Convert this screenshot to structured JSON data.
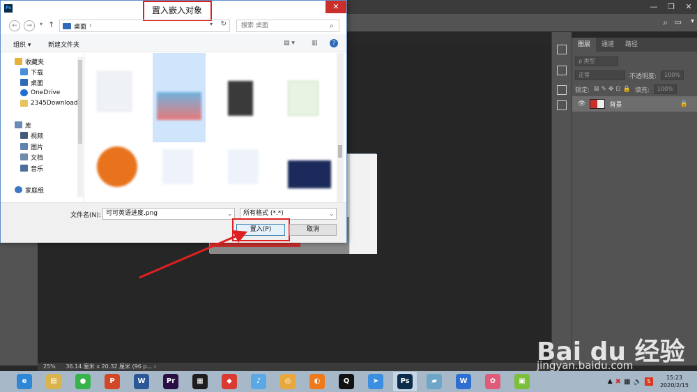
{
  "dialog": {
    "title": "置入嵌入对象",
    "address": "桌面",
    "search_placeholder": "搜索 桌面",
    "toolbar": {
      "organize": "组织 ▾",
      "new_folder": "新建文件夹"
    },
    "nav_items": [
      {
        "label": "收藏夹",
        "color": "#e6b23c"
      },
      {
        "label": "下载",
        "color": "#4a90d9"
      },
      {
        "label": "桌面",
        "color": "#2e6ab8"
      },
      {
        "label": "OneDrive",
        "color": "#1f6fd1"
      },
      {
        "label": "2345Download:",
        "color": "#e6c35c"
      },
      {
        "label": "库",
        "color": "#6a8bb5"
      },
      {
        "label": "视频",
        "color": "#445a7a"
      },
      {
        "label": "图片",
        "color": "#5d83ae"
      },
      {
        "label": "文档",
        "color": "#6f8cad"
      },
      {
        "label": "音乐",
        "color": "#4d6f9c"
      },
      {
        "label": "家庭组",
        "color": "#3d78c2"
      }
    ],
    "filename_label": "文件名(N):",
    "filename_value": "可可英语进度.png",
    "filetype_value": "所有格式 (*.*)",
    "place_button": "置入(P)",
    "cancel_button": "取消"
  },
  "ps": {
    "layers_tabs": [
      "图层",
      "通道",
      "路径"
    ],
    "kind_filter": "ρ 类型",
    "blend_mode": "正常",
    "opacity_label": "不透明度:",
    "opacity_value": "100%",
    "lock_label": "锁定:",
    "fill_label": "填充:",
    "fill_value": "100%",
    "layer_name": "背景",
    "zoom": "25%",
    "doc_size": "36.14 厘米 x 20.32 厘米 (96 p... ›"
  },
  "taskbar": {
    "apps": [
      {
        "name": "browser-360",
        "glyph": "e",
        "color": "#2d87d6"
      },
      {
        "name": "file-explorer",
        "glyph": "▤",
        "color": "#d9b34c"
      },
      {
        "name": "wechat",
        "glyph": "●",
        "color": "#36b34a"
      },
      {
        "name": "powerpoint",
        "glyph": "P",
        "color": "#d24726"
      },
      {
        "name": "word",
        "glyph": "W",
        "color": "#2b5797"
      },
      {
        "name": "premiere",
        "glyph": "Pr",
        "color": "#2a0f45"
      },
      {
        "name": "video-editor",
        "glyph": "▦",
        "color": "#1e1e1e"
      },
      {
        "name": "app-red-green",
        "glyph": "◆",
        "color": "#d93a32"
      },
      {
        "name": "app-bird",
        "glyph": "♪",
        "color": "#5aa9e6"
      },
      {
        "name": "chrome",
        "glyph": "◎",
        "color": "#e8a83b"
      },
      {
        "name": "app-orange",
        "glyph": "◐",
        "color": "#ee7a1a"
      },
      {
        "name": "qq",
        "glyph": "Q",
        "color": "#111111"
      },
      {
        "name": "app-blue-bird",
        "glyph": "➤",
        "color": "#3c8ee0"
      },
      {
        "name": "photoshop",
        "glyph": "Ps",
        "color": "#0b2c4b"
      },
      {
        "name": "app-book",
        "glyph": "▰",
        "color": "#6ea6c8"
      },
      {
        "name": "wps",
        "glyph": "W",
        "color": "#2f6fd3"
      },
      {
        "name": "app-flower",
        "glyph": "✿",
        "color": "#e05b7a"
      },
      {
        "name": "app-notes",
        "glyph": "▣",
        "color": "#7cbf3a"
      }
    ],
    "time": "15:23",
    "date": "2020/2/15"
  },
  "watermark": {
    "brand": "Bai du 经验",
    "url": "jingyan.baidu.com"
  }
}
